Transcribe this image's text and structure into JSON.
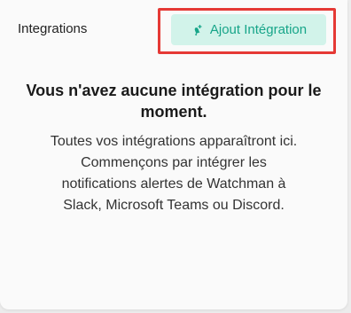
{
  "header": {
    "title": "Integrations",
    "add_button_label": "Ajout Intégration",
    "add_button_icon": "bell-plus-icon"
  },
  "empty_state": {
    "title": "Vous n'avez aucune intégration pour le moment.",
    "description": "Toutes vos intégrations apparaîtront ici. Commençons par intégrer les notifications alertes de Watchman à Slack, Microsoft Teams ou Discord."
  },
  "colors": {
    "accent": "#17a589",
    "button_bg": "#d2f3ea",
    "highlight": "#e53935"
  }
}
